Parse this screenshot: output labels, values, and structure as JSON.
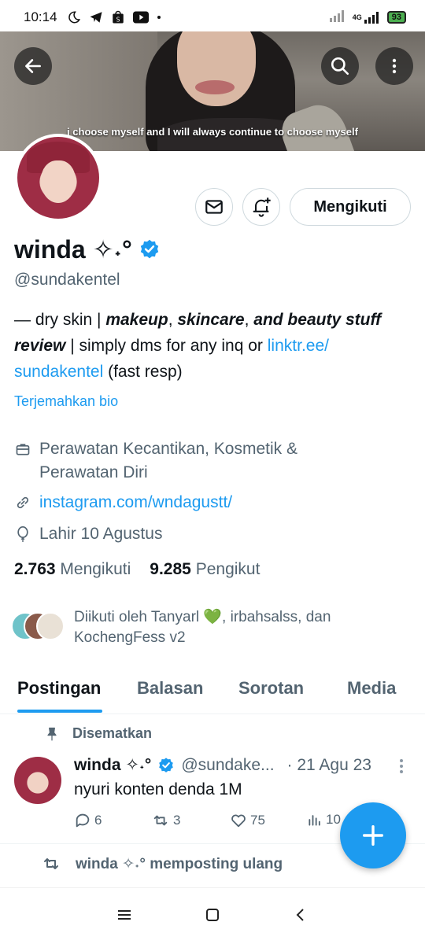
{
  "status_bar": {
    "time": "10:14",
    "network": "4G",
    "battery": "93"
  },
  "banner": {
    "caption": "i choose myself and I will always continue to choose myself"
  },
  "profile": {
    "follow_button": "Mengikuti",
    "name": "winda ✧˖°",
    "handle": "@sundakentel",
    "bio": {
      "p1": "— dry skin | ",
      "b1": "makeup",
      "p2": ", ",
      "b2": "skincare",
      "p3": ", ",
      "b3": "and beauty stuff review",
      "p4": " | simply dms for any inq or ",
      "link": "linktr.ee/ sundakentel",
      "p5": " (fast resp)"
    },
    "translate_bio": "Terjemahkan bio",
    "category": "Perawatan Kecantikan, Kosmetik & Perawatan Diri",
    "website": "instagram.com/wndagustt/",
    "birthday": "Lahir 10 Agustus",
    "following_count": "2.763",
    "following_label": "Mengikuti",
    "followers_count": "9.285",
    "followers_label": "Pengikut",
    "followed_by": "Diikuti oleh Tanyarl 💚, irbahsalss, dan KochengFess v2"
  },
  "tabs": [
    "Postingan",
    "Balasan",
    "Sorotan",
    "Media"
  ],
  "pinned_post": {
    "pinned_label": "Disematkan",
    "author_name": "winda ✧˖°",
    "author_handle": "@sundake...",
    "date": "· 21 Agu 23",
    "text": "nyuri konten denda 1M",
    "replies": "6",
    "reposts": "3",
    "likes": "75",
    "views": "10"
  },
  "repost_label": "winda ✧˖° memposting ulang",
  "colors": {
    "accent": "#1d9bf0",
    "secondary_text": "#536471",
    "primary_text": "#0f1419"
  }
}
